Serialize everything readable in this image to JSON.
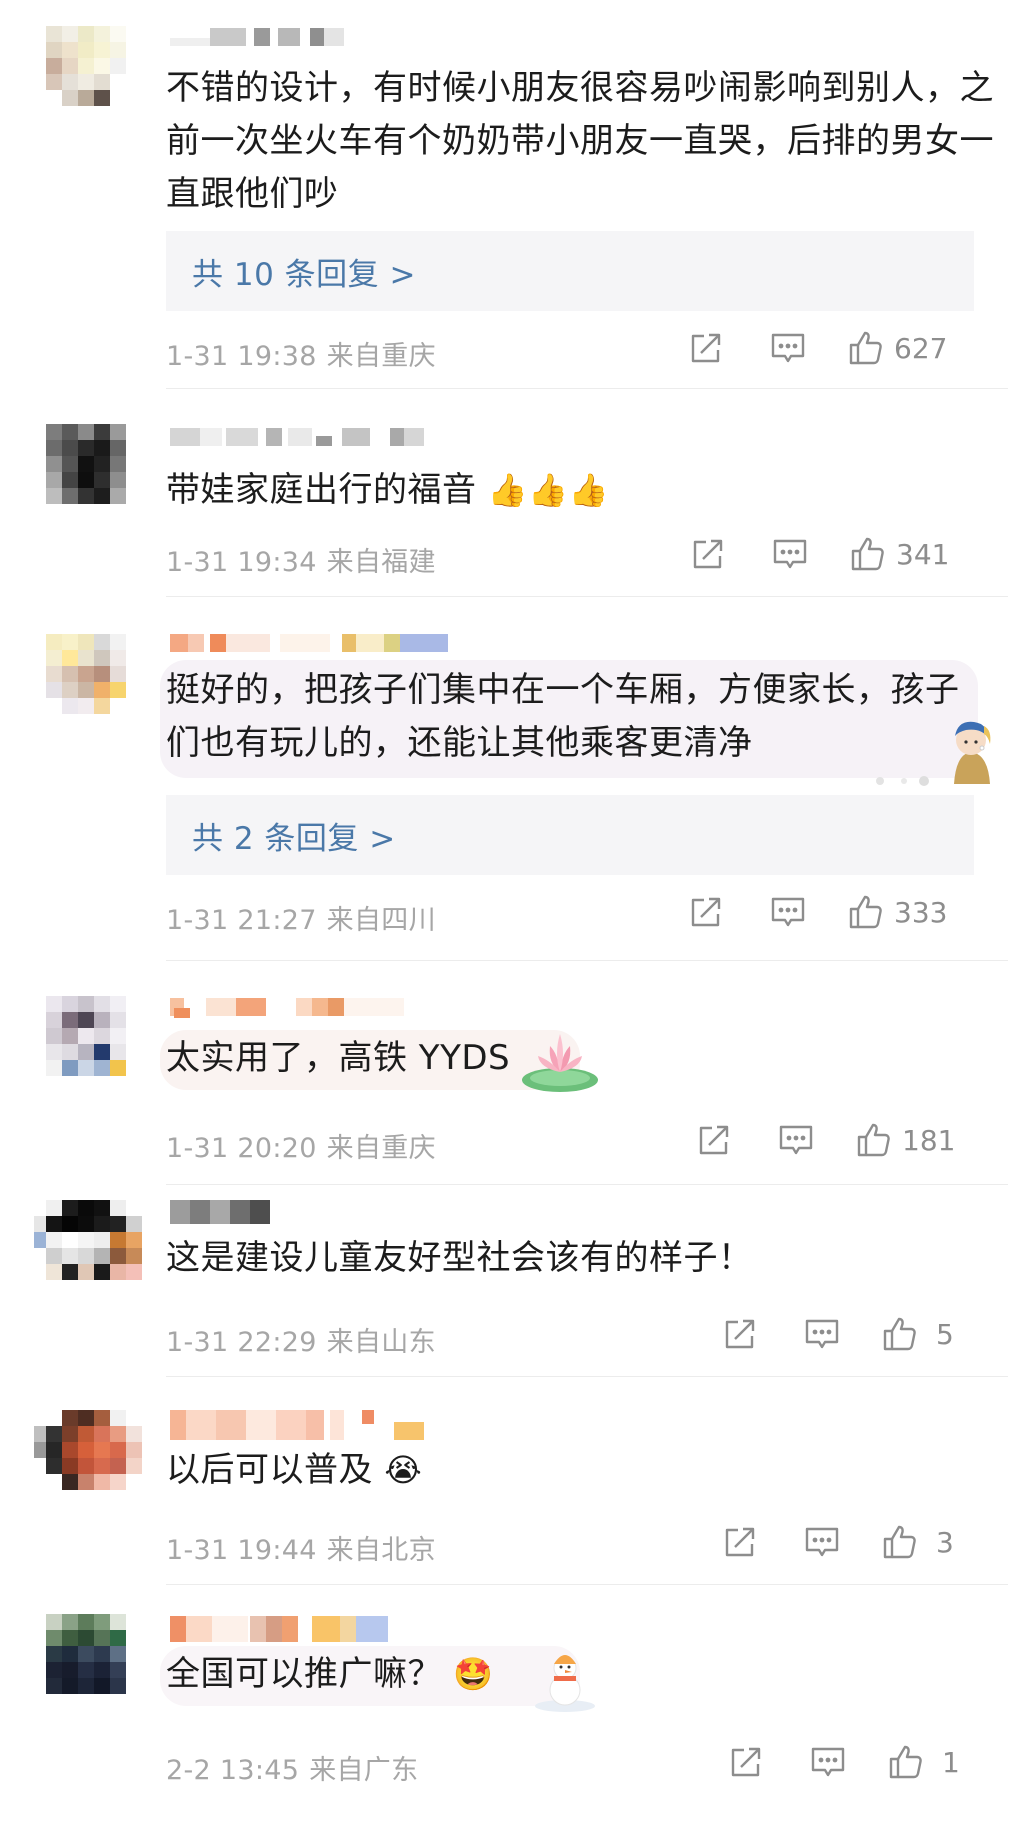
{
  "comments": [
    {
      "text": "不错的设计，有时候小朋友很容易吵闹影响到别人，之前一次坐火车有个奶奶带小朋友一直哭，后排的男女一直跟他们吵",
      "replies": "共 10 条回复 >",
      "time": "1-31 19:38",
      "location": "来自重庆",
      "likes": "627"
    },
    {
      "text": "带娃家庭出行的福音",
      "emoji": "👍👍👍",
      "time": "1-31 19:34",
      "location": "来自福建",
      "likes": "341"
    },
    {
      "text": "挺好的，把孩子们集中在一个车厢，方便家长，孩子们也有玩儿的，还能让其他乘客更清净",
      "replies": "共 2 条回复 >",
      "time": "1-31 21:27",
      "location": "来自四川",
      "likes": "333"
    },
    {
      "text": "太实用了，高铁 YYDS",
      "time": "1-31 20:20",
      "location": "来自重庆",
      "likes": "181"
    },
    {
      "text": "这是建设儿童友好型社会该有的样子！",
      "time": "1-31 22:29",
      "location": "来自山东",
      "likes": "5"
    },
    {
      "text": "以后可以普及",
      "emoji": "😭",
      "time": "1-31 19:44",
      "location": "来自北京",
      "likes": "3"
    },
    {
      "text": "全国可以推广嘛？",
      "emoji": "🤩",
      "time": "2-2 13:45",
      "location": "来自广东",
      "likes": "1"
    }
  ],
  "icons": {
    "share": "share-icon",
    "comment": "comment-icon",
    "like": "thumbs-up-icon"
  },
  "colors": {
    "reply_link": "#4a78a8",
    "meta_text": "#a6a6a6",
    "reply_bg": "#f5f5f7"
  }
}
